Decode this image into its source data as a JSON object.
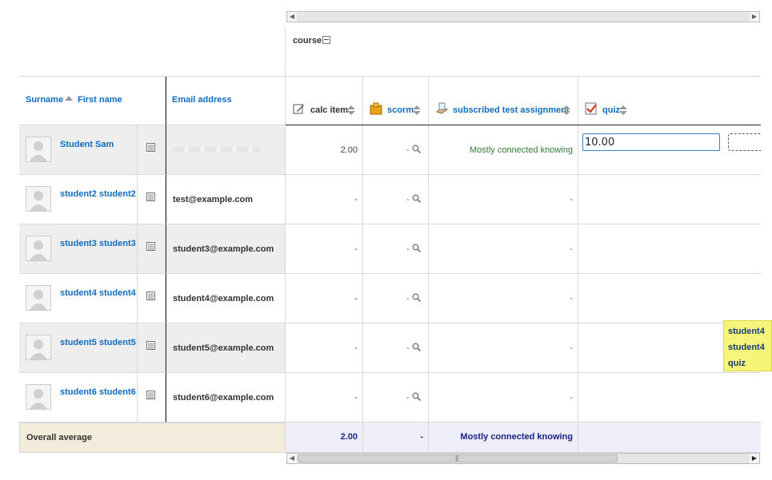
{
  "header": {
    "category_label": "course",
    "surname_label": "Surname",
    "firstname_label": "First name",
    "email_label": "Email address"
  },
  "columns": [
    {
      "label": "calc item",
      "icon": "edit-calculation-icon"
    },
    {
      "label": "scorm",
      "icon": "scorm-package-icon"
    },
    {
      "label": "subscribed test assignment",
      "icon": "assignment-icon"
    },
    {
      "label": "quiz",
      "icon": "quiz-icon"
    }
  ],
  "rows": [
    {
      "name": "Student Sam",
      "email": "",
      "calc": "2.00",
      "scorm": "-",
      "assignment": "Mostly connected knowing",
      "quiz": "10.00"
    },
    {
      "name": "student2 student2",
      "email": "test@example.com",
      "calc": "-",
      "scorm": "-",
      "assignment": "-",
      "quiz": ""
    },
    {
      "name": "student3 student3",
      "email": "student3@example.com",
      "calc": "-",
      "scorm": "-",
      "assignment": "-",
      "quiz": ""
    },
    {
      "name": "student4 student4",
      "email": "student4@example.com",
      "calc": "-",
      "scorm": "-",
      "assignment": "-",
      "quiz": ""
    },
    {
      "name": "student5 student5",
      "email": "student5@example.com",
      "calc": "-",
      "scorm": "-",
      "assignment": "-",
      "quiz": ""
    },
    {
      "name": "student6 student6",
      "email": "student6@example.com",
      "calc": "-",
      "scorm": "-",
      "assignment": "-",
      "quiz": ""
    }
  ],
  "average": {
    "label": "Overall average",
    "calc": "2.00",
    "scorm": "-",
    "assignment": "Mostly connected knowing"
  },
  "tooltip": {
    "line1": "student4",
    "line2": "student4",
    "line3": "quiz"
  },
  "colors": {
    "link": "#0f6cbf",
    "grey_row": "#eeeeee",
    "average_left": "#f3ecdc",
    "average_right": "#eeeefb",
    "tooltip": "#f5f57a",
    "green_text": "#357a32"
  }
}
